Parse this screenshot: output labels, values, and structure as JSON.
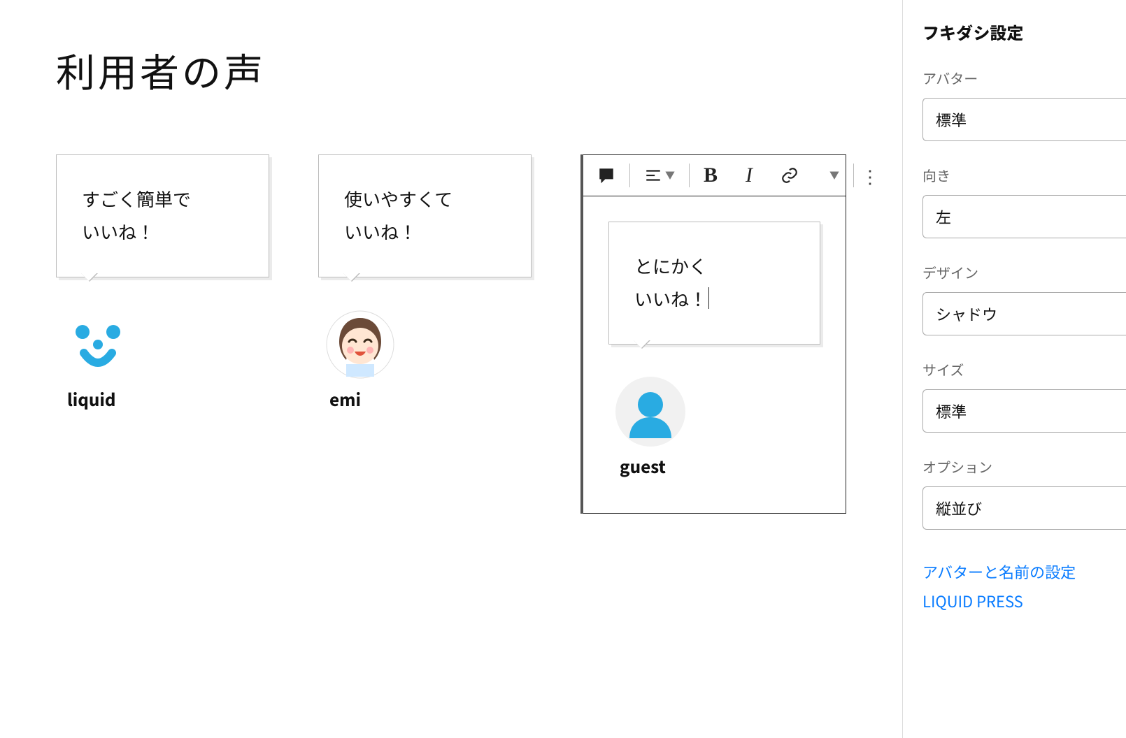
{
  "page": {
    "title": "利用者の声"
  },
  "cards": [
    {
      "text_l1": "すごく簡単で",
      "text_l2": "いいね！",
      "name": "liquid",
      "avatar": "liquid"
    },
    {
      "text_l1": "使いやすくて",
      "text_l2": "いいね！",
      "name": "emi",
      "avatar": "emi"
    },
    {
      "text_l1": "とにかく",
      "text_l2": "いいね！",
      "name": "guest",
      "avatar": "guest"
    }
  ],
  "toolbar": {
    "block_icon": "speech-icon",
    "align_icon": "align-left-icon",
    "bold": "B",
    "italic": "I",
    "link_icon": "link-icon",
    "more": "⋮"
  },
  "panel": {
    "title": "フキダシ設定",
    "fields": {
      "avatar": {
        "label": "アバター",
        "value": "標準"
      },
      "dir": {
        "label": "向き",
        "value": "左"
      },
      "design": {
        "label": "デザイン",
        "value": "シャドウ"
      },
      "size": {
        "label": "サイズ",
        "value": "標準"
      },
      "option": {
        "label": "オプション",
        "value": "縦並び"
      }
    },
    "links": {
      "avatar_settings": "アバターと名前の設定",
      "brand": "LIQUID PRESS"
    }
  }
}
